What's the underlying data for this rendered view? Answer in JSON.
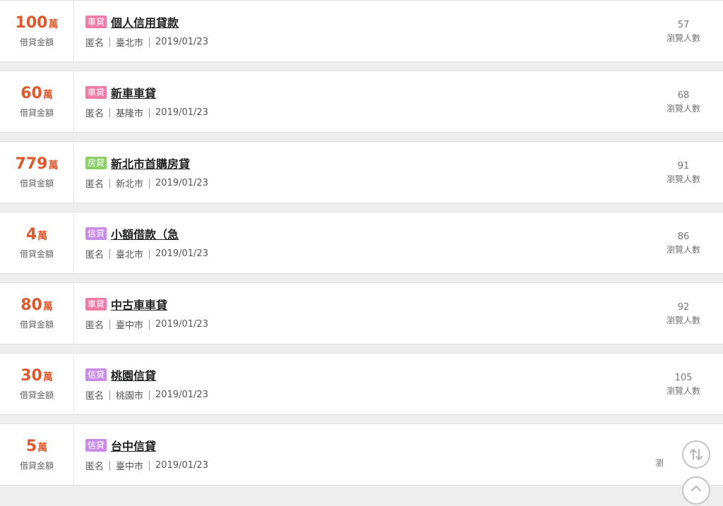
{
  "loans": [
    {
      "amount": "100",
      "unit": "萬",
      "amount_label": "借貸金額",
      "tag": "車貸",
      "tag_type": "car",
      "title": "個人信用貸款",
      "author": "匿名",
      "city": "臺北市",
      "date": "2019/01/23",
      "views": "57",
      "views_label": "瀏覽人數"
    },
    {
      "amount": "60",
      "unit": "萬",
      "amount_label": "借貸金額",
      "tag": "車貸",
      "tag_type": "car",
      "title": "新車車貸",
      "author": "匿名",
      "city": "基隆市",
      "date": "2019/01/23",
      "views": "68",
      "views_label": "瀏覽人數"
    },
    {
      "amount": "779",
      "unit": "萬",
      "amount_label": "借貸金額",
      "tag": "房貸",
      "tag_type": "house",
      "title": "新北市首購房貸",
      "author": "匿名",
      "city": "新北市",
      "date": "2019/01/23",
      "views": "91",
      "views_label": "瀏覽人數"
    },
    {
      "amount": "4",
      "unit": "萬",
      "amount_label": "借貸金額",
      "tag": "信貸",
      "tag_type": "credit",
      "title": "小額借款（急",
      "author": "匿名",
      "city": "臺北市",
      "date": "2019/01/23",
      "views": "86",
      "views_label": "瀏覽人數"
    },
    {
      "amount": "80",
      "unit": "萬",
      "amount_label": "借貸金額",
      "tag": "車貸",
      "tag_type": "car",
      "title": "中古車車貸",
      "author": "匿名",
      "city": "臺中市",
      "date": "2019/01/23",
      "views": "92",
      "views_label": "瀏覽人數"
    },
    {
      "amount": "30",
      "unit": "萬",
      "amount_label": "借貸金額",
      "tag": "信貸",
      "tag_type": "credit",
      "title": "桃園信貸",
      "author": "匿名",
      "city": "桃園市",
      "date": "2019/01/23",
      "views": "105",
      "views_label": "瀏覽人數"
    },
    {
      "amount": "5",
      "unit": "萬",
      "amount_label": "借貸金額",
      "tag": "信貸",
      "tag_type": "credit",
      "title": "台中信貸",
      "author": "匿名",
      "city": "臺中市",
      "date": "2019/01/23",
      "views": "",
      "views_label": "瀏"
    }
  ],
  "icons": {
    "scroll_top": "swap-vertical-icon",
    "scroll_up": "arrow-up-icon"
  },
  "colors": {
    "amount": "#e0572b",
    "tag_car": "#f27aa6",
    "tag_house": "#8cd06a",
    "tag_credit": "#c98ae8"
  }
}
